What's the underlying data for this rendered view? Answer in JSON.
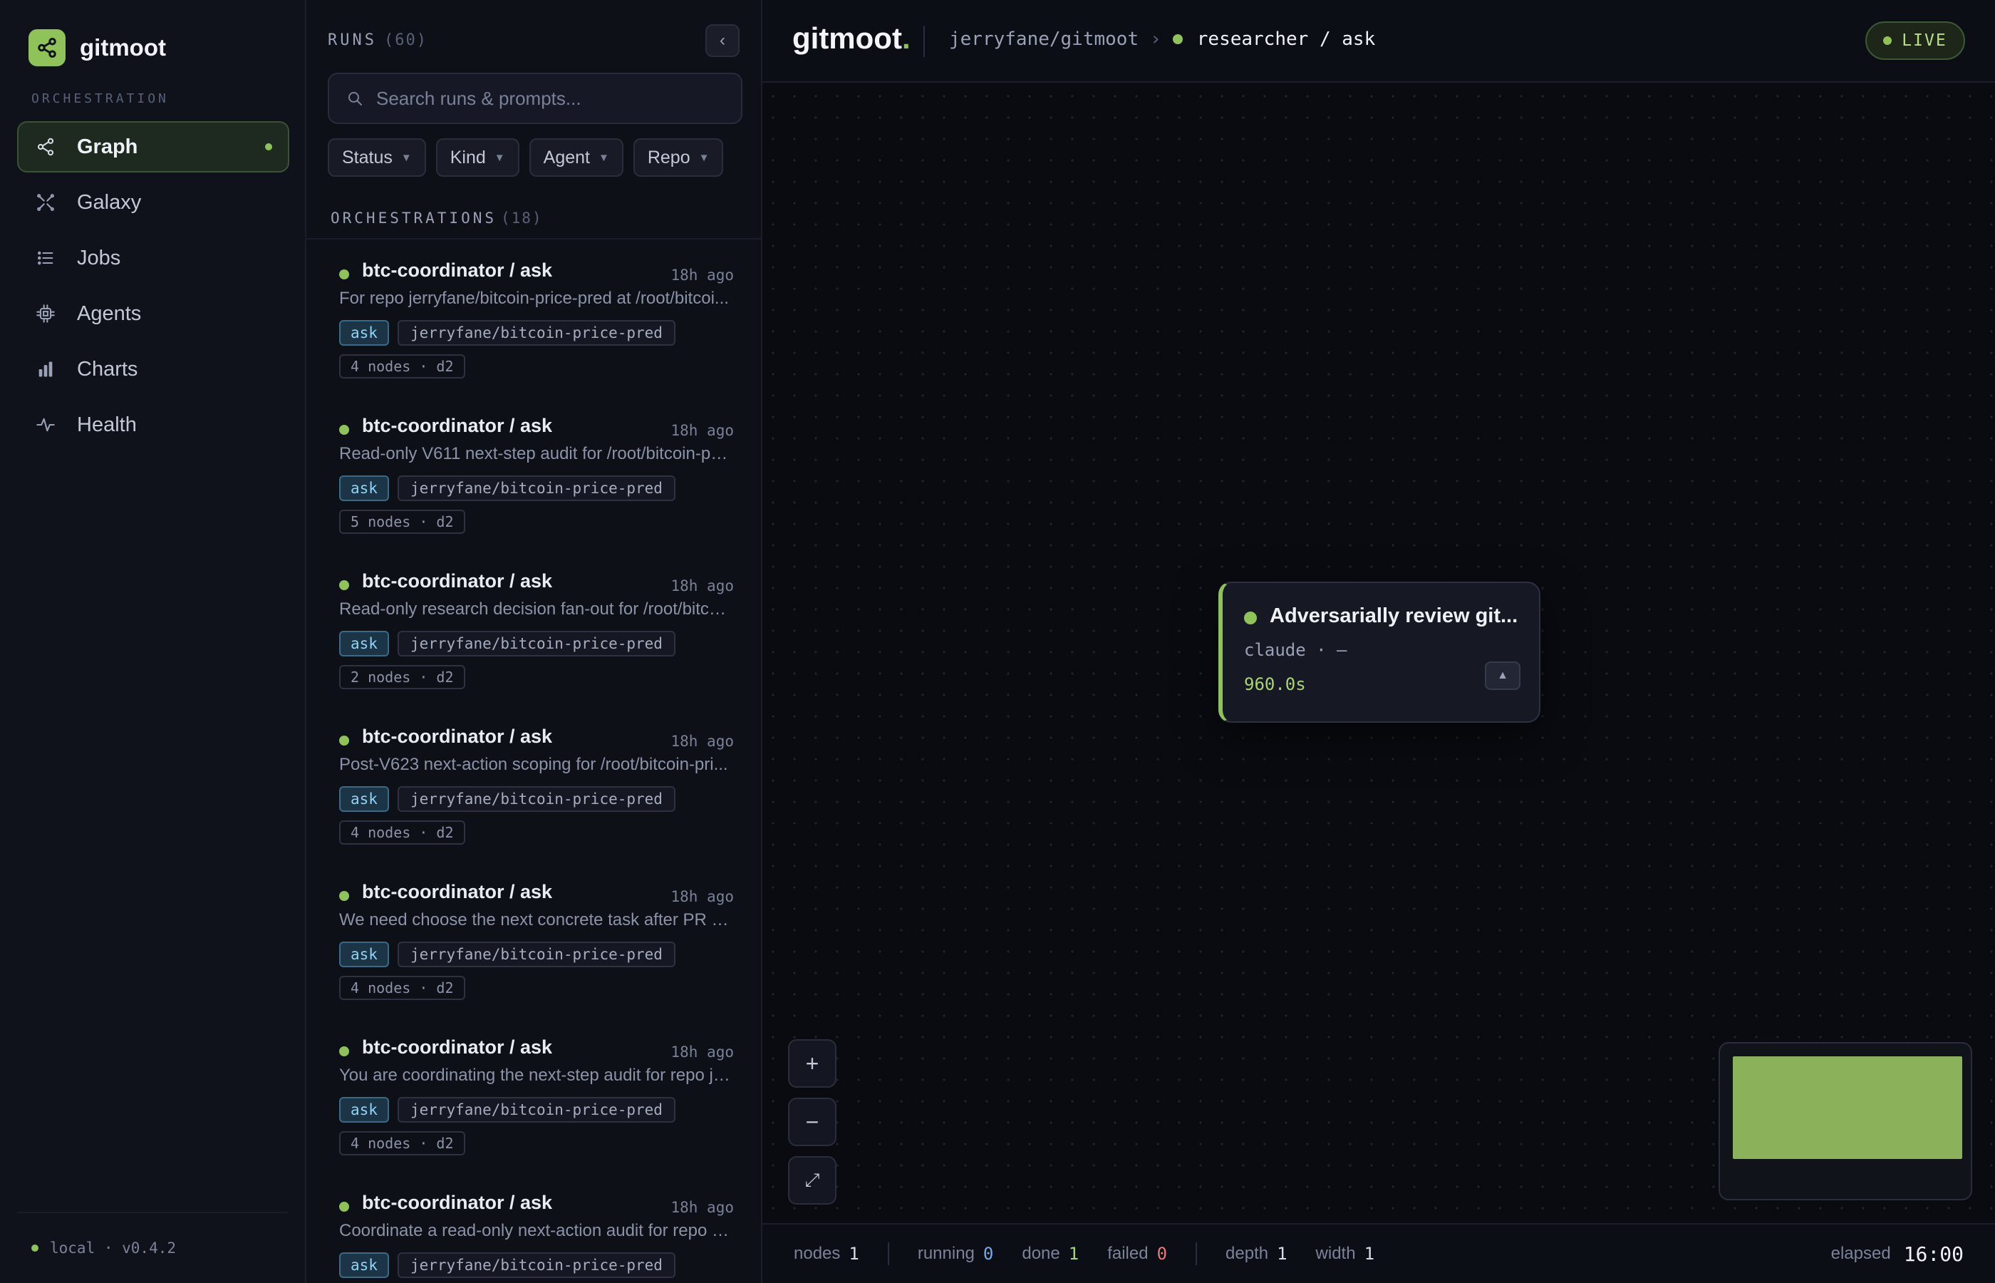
{
  "app": {
    "name": "gitmoot",
    "logo_text": "gitmoot",
    "logo_period": "."
  },
  "sidebar": {
    "section_label": "ORCHESTRATION",
    "items": [
      {
        "label": "Graph",
        "icon": "graph-icon",
        "active": true
      },
      {
        "label": "Galaxy",
        "icon": "galaxy-icon"
      },
      {
        "label": "Jobs",
        "icon": "jobs-icon"
      },
      {
        "label": "Agents",
        "icon": "agents-icon"
      },
      {
        "label": "Charts",
        "icon": "charts-icon"
      },
      {
        "label": "Health",
        "icon": "health-icon"
      }
    ],
    "footer": "local · v0.4.2"
  },
  "runs_panel": {
    "title": "RUNS",
    "count": "(60)",
    "search_placeholder": "Search runs & prompts...",
    "filters": [
      "Status",
      "Kind",
      "Agent",
      "Repo"
    ],
    "orchestrations_label": "ORCHESTRATIONS",
    "orchestrations_count": "(18)",
    "runs": [
      {
        "title": "btc-coordinator / ask",
        "time": "18h ago",
        "desc": "For repo jerryfane/bitcoin-price-pred at /root/bitcoi...",
        "kind": "ask",
        "repo": "jerryfane/bitcoin-price-pred",
        "nodes": "4 nodes · d2"
      },
      {
        "title": "btc-coordinator / ask",
        "time": "18h ago",
        "desc": "Read-only V611 next-step audit for /root/bitcoin-pri...",
        "kind": "ask",
        "repo": "jerryfane/bitcoin-price-pred",
        "nodes": "5 nodes · d2"
      },
      {
        "title": "btc-coordinator / ask",
        "time": "18h ago",
        "desc": "Read-only research decision fan-out for /root/bitco...",
        "kind": "ask",
        "repo": "jerryfane/bitcoin-price-pred",
        "nodes": "2 nodes · d2"
      },
      {
        "title": "btc-coordinator / ask",
        "time": "18h ago",
        "desc": "Post-V623 next-action scoping for /root/bitcoin-pri...",
        "kind": "ask",
        "repo": "jerryfane/bitcoin-price-pred",
        "nodes": "4 nodes · d2"
      },
      {
        "title": "btc-coordinator / ask",
        "time": "18h ago",
        "desc": "We need choose the next concrete task after PR #9...",
        "kind": "ask",
        "repo": "jerryfane/bitcoin-price-pred",
        "nodes": "4 nodes · d2"
      },
      {
        "title": "btc-coordinator / ask",
        "time": "18h ago",
        "desc": "You are coordinating the next-step audit for repo je...",
        "kind": "ask",
        "repo": "jerryfane/bitcoin-price-pred",
        "nodes": "4 nodes · d2"
      },
      {
        "title": "btc-coordinator / ask",
        "time": "18h ago",
        "desc": "Coordinate a read-only next-action audit for repo /r...",
        "kind": "ask",
        "repo": "jerryfane/bitcoin-price-pred",
        "nodes": ""
      }
    ]
  },
  "header": {
    "repo": "jerryfane/gitmoot",
    "separator": "›",
    "current": "researcher / ask",
    "live_label": "LIVE"
  },
  "node": {
    "title": "Adversarially review git...",
    "meta": "claude · —",
    "duration": "960.0s",
    "toggle": "▲"
  },
  "zoom": {
    "in": "+",
    "out": "−",
    "fit": "⤢"
  },
  "status": {
    "nodes_label": "nodes",
    "nodes": "1",
    "running_label": "running",
    "running": "0",
    "done_label": "done",
    "done": "1",
    "failed_label": "failed",
    "failed": "0",
    "depth_label": "depth",
    "depth": "1",
    "width_label": "width",
    "width": "1",
    "elapsed_label": "elapsed",
    "elapsed": "16:00"
  },
  "colors": {
    "accent": "#8fc35a",
    "running": "#7aa9e8",
    "failed": "#e57a7a"
  }
}
